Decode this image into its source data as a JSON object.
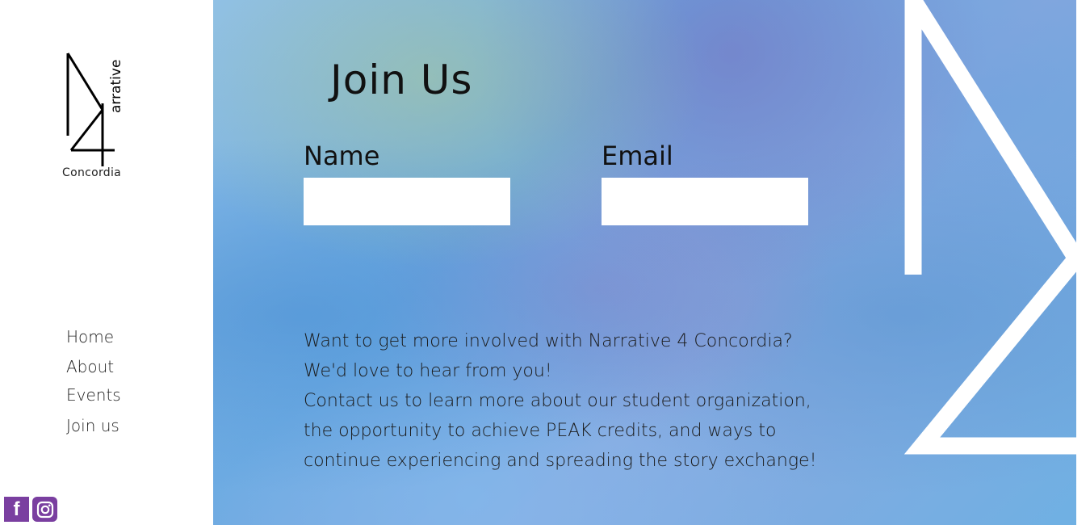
{
  "sidebar": {
    "logo_vertical_text": "arrative",
    "logo_subtitle": "Concordia",
    "nav": {
      "home": "Home",
      "about": "About",
      "events": "Events",
      "join": "Join us"
    },
    "social": {
      "facebook_glyph": "f",
      "icons": [
        "facebook-icon",
        "instagram-icon"
      ],
      "color": "#7a3fa0"
    }
  },
  "main": {
    "title": "Join Us",
    "form": {
      "name_label": "Name",
      "email_label": "Email",
      "name_value": "",
      "email_value": ""
    },
    "paragraph": [
      "Want to get more involved with Narrative 4 Concordia?",
      "We'd love to hear from you!",
      "Contact us to learn more about our student organization,",
      "the opportunity to achieve PEAK credits, and ways to",
      "continue experiencing and spreading the story exchange!"
    ]
  }
}
